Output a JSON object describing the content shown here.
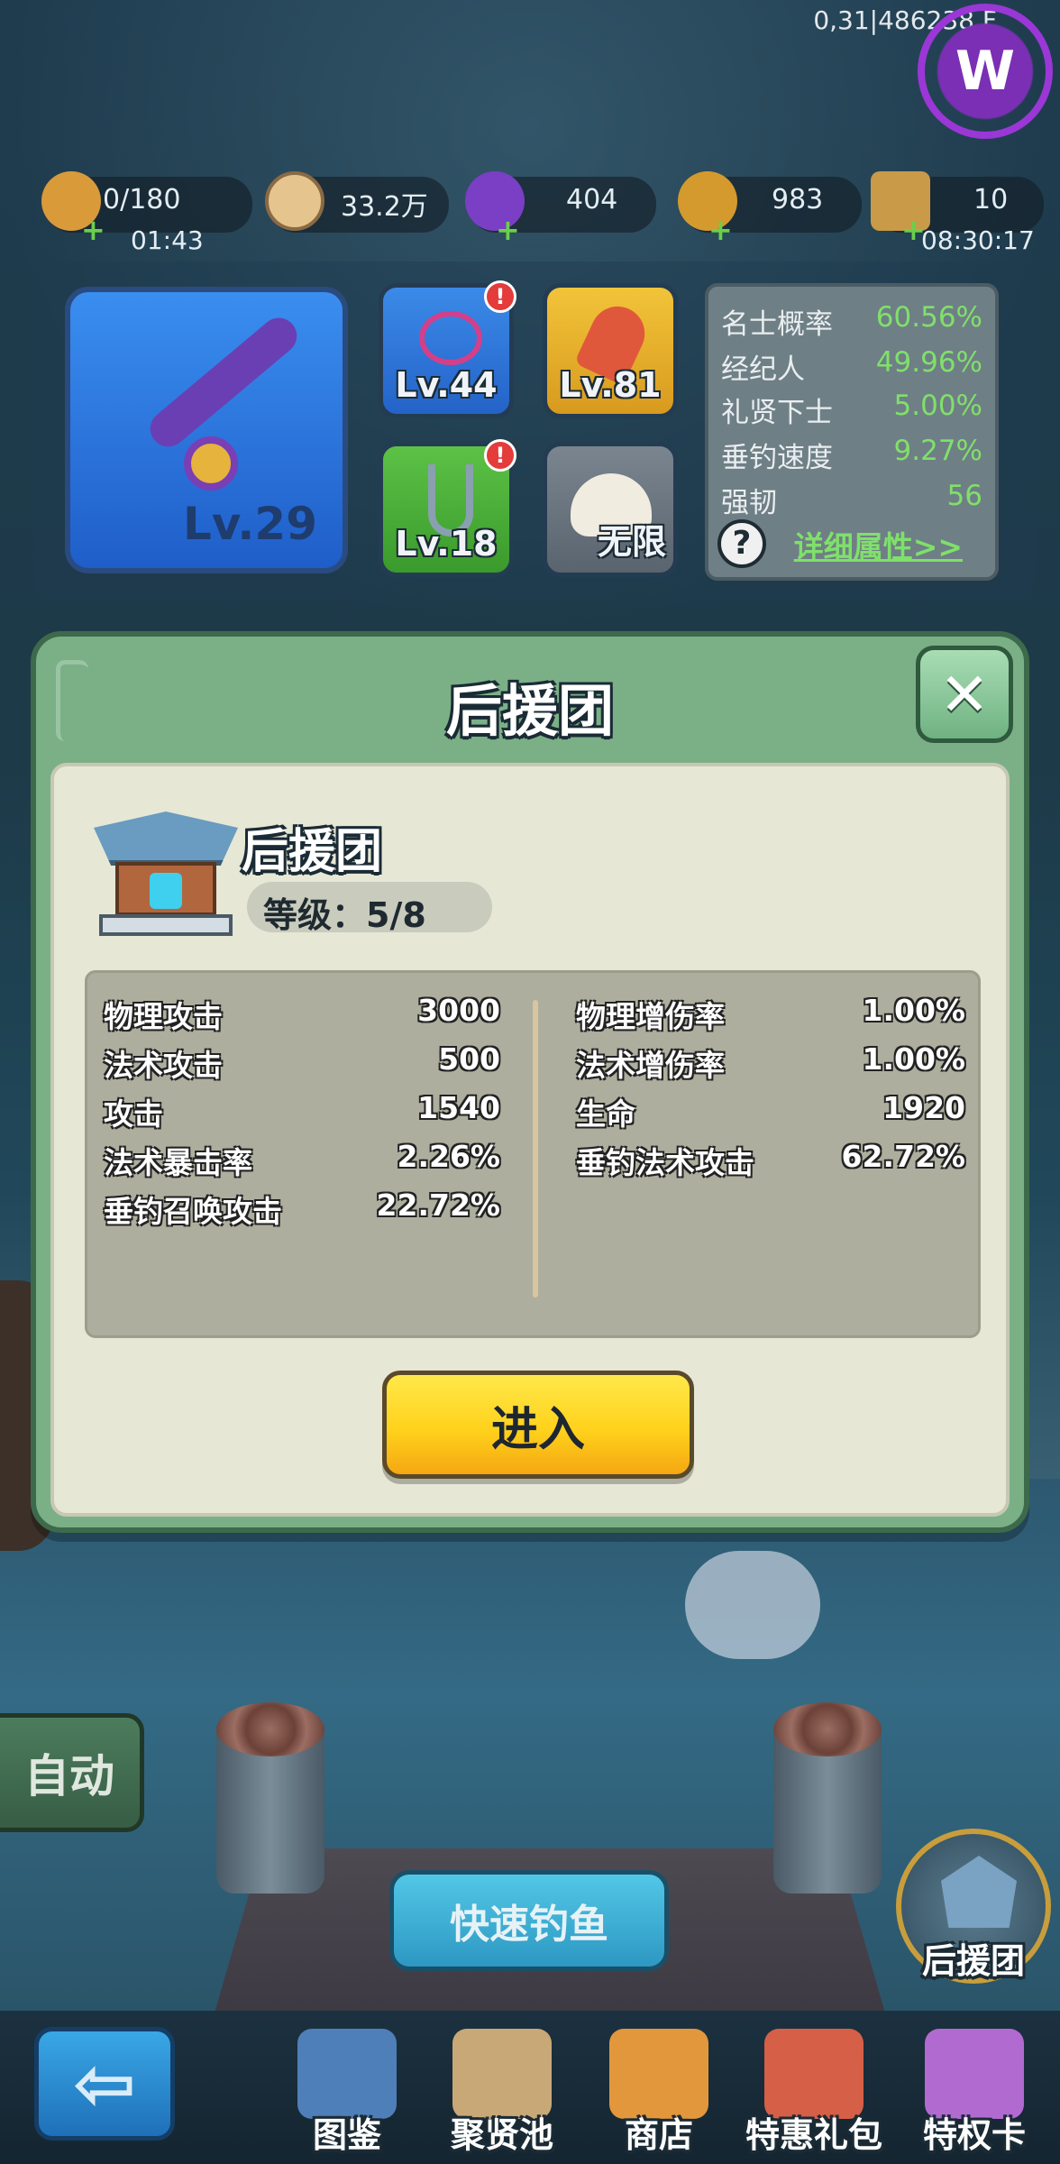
{
  "status": {
    "top_right_text": "0,31|486238 F",
    "logo_letter": "W"
  },
  "resources": [
    {
      "name": "stamina",
      "icon": "bread-icon",
      "value": "0/180",
      "sub": "01:43",
      "has_plus": true
    },
    {
      "name": "coins",
      "icon": "coin-icon",
      "value": "33.2万",
      "sub": "",
      "has_plus": false
    },
    {
      "name": "gems",
      "icon": "purple-gem-icon",
      "value": "404",
      "sub": "",
      "has_plus": true
    },
    {
      "name": "tickets",
      "icon": "gold-ticket-icon",
      "value": "983",
      "sub": "",
      "has_plus": true
    },
    {
      "name": "spears",
      "icon": "spear-icon",
      "value": "10",
      "sub": "08:30:17",
      "has_plus": true
    }
  ],
  "equipment": {
    "rod_level": "Lv.29",
    "line_level": "Lv.44",
    "bait_level": "Lv.81",
    "hook_level": "Lv.18",
    "bun_label": "无限",
    "alert_mark": "!"
  },
  "mini_stats": [
    {
      "k": "名士概率",
      "v": "60.56%"
    },
    {
      "k": "经纪人",
      "v": "49.96%"
    },
    {
      "k": "礼贤下士",
      "v": "5.00%"
    },
    {
      "k": "垂钓速度",
      "v": "9.27%"
    },
    {
      "k": "强韧",
      "v": "56"
    }
  ],
  "help_symbol": "?",
  "detail_link": "详细属性>>",
  "modal": {
    "title": "后援团",
    "close_symbol": "✕",
    "building_name": "后援团",
    "level_text": "等级：5/8",
    "left_attrs": [
      {
        "k": "物理攻击",
        "v": "3000"
      },
      {
        "k": "法术攻击",
        "v": "500"
      },
      {
        "k": "攻击",
        "v": "1540"
      },
      {
        "k": "法术暴击率",
        "v": "2.26%"
      },
      {
        "k": "垂钓召唤攻击",
        "v": "22.72%"
      }
    ],
    "right_attrs": [
      {
        "k": "物理增伤率",
        "v": "1.00%"
      },
      {
        "k": "法术增伤率",
        "v": "1.00%"
      },
      {
        "k": "生命",
        "v": "1920"
      },
      {
        "k": "垂钓法术攻击",
        "v": "62.72%"
      }
    ],
    "enter_label": "进入"
  },
  "auto_label": "自动",
  "quick_fish_label": "快速钓鱼",
  "support_label": "后援团",
  "back_symbol": "⇦",
  "nav": [
    {
      "label": "图鉴",
      "icon": "book-icon",
      "color": "#4f7fb8"
    },
    {
      "label": "聚贤池",
      "icon": "scroll-icon",
      "color": "#c9a877"
    },
    {
      "label": "商店",
      "icon": "fruit-basket-icon",
      "color": "#e2973c"
    },
    {
      "label": "特惠礼包",
      "icon": "gift-box-icon",
      "color": "#d65f47"
    },
    {
      "label": "特权卡",
      "icon": "privilege-card-icon",
      "color": "#b06ad0"
    }
  ]
}
